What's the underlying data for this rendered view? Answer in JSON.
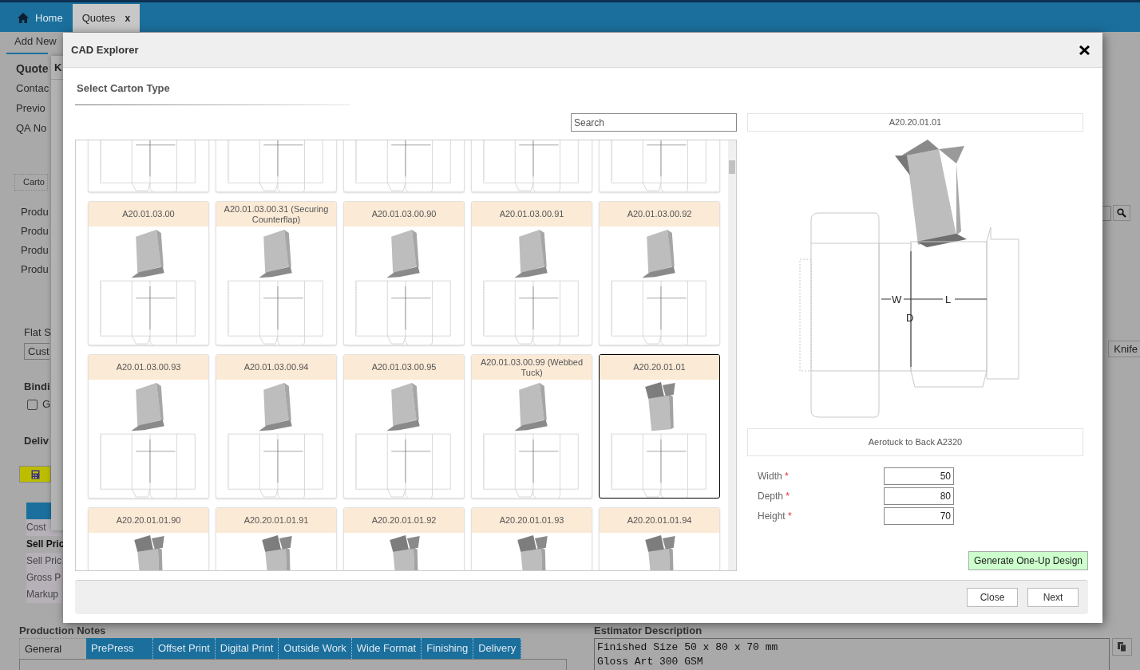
{
  "top_tabs": [
    {
      "label": "Home",
      "kind": "home",
      "selected": false
    },
    {
      "label": "Quotes",
      "kind": "closable",
      "close_label": "x",
      "selected": true
    }
  ],
  "page": {
    "subtab": "Add New",
    "side_links": [
      {
        "label": "Quote",
        "selected": true
      },
      {
        "label": "Contac",
        "selected": false
      },
      {
        "label": "Previo",
        "selected": false
      },
      {
        "label": "QA No",
        "selected": false
      }
    ],
    "section_tab": "Carto",
    "product_labels": [
      "Produ",
      "Produ",
      "Produ",
      "Produ"
    ],
    "flat_label": "Flat S",
    "flat_value": "Cust",
    "binding_label": "Bindi",
    "binding_checkbox": {
      "label": "G",
      "checked": false
    },
    "delivery_label": "Deliv",
    "price_rows": [
      {
        "label": "Cost",
        "emphasis": false
      },
      {
        "label": "Sell Pric",
        "emphasis": true
      },
      {
        "label": "Sell Pric",
        "emphasis": false
      },
      {
        "label": "Gross P",
        "emphasis": false
      },
      {
        "label": "Markup",
        "emphasis": false
      }
    ],
    "knife_button": "Knife",
    "behind_dialog_title": "K",
    "production_notes": {
      "title": "Production Notes",
      "tabs": [
        {
          "label": "General",
          "selected": true
        },
        {
          "label": "PrePress",
          "selected": false
        },
        {
          "label": "Offset Print",
          "selected": false
        },
        {
          "label": "Digital Print",
          "selected": false
        },
        {
          "label": "Outside Work",
          "selected": false
        },
        {
          "label": "Wide Format",
          "selected": false
        },
        {
          "label": "Finishing",
          "selected": false
        },
        {
          "label": "Delivery",
          "selected": false
        }
      ]
    },
    "estimator": {
      "title": "Estimator Description",
      "lines": [
        "Finished Size 50 x 80 x 70 mm",
        "Gloss Art 300 GSM"
      ]
    }
  },
  "dialog": {
    "title": "CAD Explorer",
    "section_title": "Select Carton Type",
    "search": {
      "placeholder": "Search"
    },
    "cards": [
      {
        "kind": "tuck",
        "selected": false
      },
      {
        "kind": "tuck",
        "selected": false
      },
      {
        "kind": "tuck",
        "selected": false
      },
      {
        "kind": "tuck",
        "selected": false
      },
      {
        "kind": "tuck",
        "selected": false
      },
      {
        "label": "A20.01.03.00",
        "kind": "tuck",
        "selected": false
      },
      {
        "label": "A20.01.03.00.31 (Securing Counterflap)",
        "kind": "tuck",
        "selected": false
      },
      {
        "label": "A20.01.03.00.90",
        "kind": "tuck",
        "selected": false
      },
      {
        "label": "A20.01.03.00.91",
        "kind": "tuck",
        "selected": false
      },
      {
        "label": "A20.01.03.00.92",
        "kind": "tuck",
        "selected": false
      },
      {
        "label": "A20.01.03.00.93",
        "kind": "tuck",
        "selected": false
      },
      {
        "label": "A20.01.03.00.94",
        "kind": "tuck",
        "selected": false
      },
      {
        "label": "A20.01.03.00.95",
        "kind": "tuck",
        "selected": false
      },
      {
        "label": "A20.01.03.00.99 (Webbed Tuck)",
        "kind": "tuck",
        "selected": false
      },
      {
        "label": "A20.20.01.01",
        "kind": "aerotuck",
        "selected": true
      },
      {
        "label": "A20.20.01.01.90",
        "kind": "aerotuck",
        "selected": false
      },
      {
        "label": "A20.20.01.01.91",
        "kind": "aerotuck",
        "selected": false
      },
      {
        "label": "A20.20.01.01.92",
        "kind": "aerotuck",
        "selected": false
      },
      {
        "label": "A20.20.01.01.93",
        "kind": "aerotuck",
        "selected": false
      },
      {
        "label": "A20.20.01.01.94",
        "kind": "aerotuck",
        "selected": false
      }
    ],
    "preview": {
      "code": "A20.20.01.01",
      "width_mark": "W",
      "length_mark": "L",
      "depth_mark": "D",
      "description": "Aerotuck to Back A2320"
    },
    "required_mark": "*",
    "fields": [
      {
        "label": "Width",
        "required": true,
        "value": "50"
      },
      {
        "label": "Depth",
        "required": true,
        "value": "80"
      },
      {
        "label": "Height",
        "required": true,
        "value": "70"
      }
    ],
    "generate_button": "Generate One-Up Design",
    "footer_buttons": [
      "Close",
      "Next"
    ]
  }
}
